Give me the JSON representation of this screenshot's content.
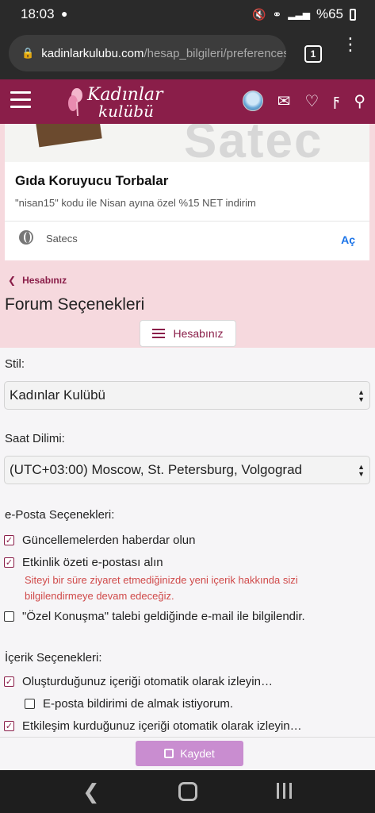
{
  "status": {
    "time": "18:03",
    "battery": "%65"
  },
  "browser": {
    "domain": "kadinlarkulubu.com",
    "path": "/hesap_bilgileri/preferences",
    "tab_count": "1"
  },
  "site": {
    "logo_line1": "Kadınlar",
    "logo_line2": "kulübü"
  },
  "ad": {
    "image_brand": "Satec",
    "title": "Gıda Koruyucu Torbalar",
    "subtitle": "\"nisan15\" kodu ile Nisan ayına özel %15 NET indirim",
    "source": "Satecs",
    "open_label": "Aç"
  },
  "page": {
    "breadcrumb": "Hesabınız",
    "title": "Forum Seçenekleri",
    "account_button": "Hesabınız"
  },
  "form": {
    "style_label": "Stil:",
    "style_value": "Kadınlar Kulübü",
    "timezone_label": "Saat Dilimi:",
    "timezone_value": "(UTC+03:00) Moscow, St. Petersburg, Volgograd",
    "email_label": "e-Posta Seçenekleri:",
    "email_options": [
      {
        "label": "Güncellemelerden haberdar olun",
        "checked": true
      },
      {
        "label": "Etkinlik özeti e-postası alın",
        "checked": true
      },
      {
        "label": "\"Özel Konuşma\" talebi geldiğinde e-mail ile bilgilendir.",
        "checked": false
      }
    ],
    "email_hint_line1": "Siteyi bir süre ziyaret etmediğinizde yeni içerik hakkında sizi",
    "email_hint_line2": "bilgilendirmeye devam edeceğiz.",
    "content_label": "İçerik Seçenekleri:",
    "content_options": [
      {
        "label": "Oluşturduğunuz içeriği otomatik olarak izleyin…",
        "checked": true
      },
      {
        "label": "E-posta bildirimi de almak istiyorum.",
        "checked": false
      },
      {
        "label": "Etkileşim kurduğunuz içeriği otomatik olarak izleyin…",
        "checked": true
      }
    ],
    "save_label": "Kaydet"
  },
  "colors": {
    "brand": "#8a1e49",
    "save": "#c98dd0",
    "hint": "#d04a4a"
  }
}
